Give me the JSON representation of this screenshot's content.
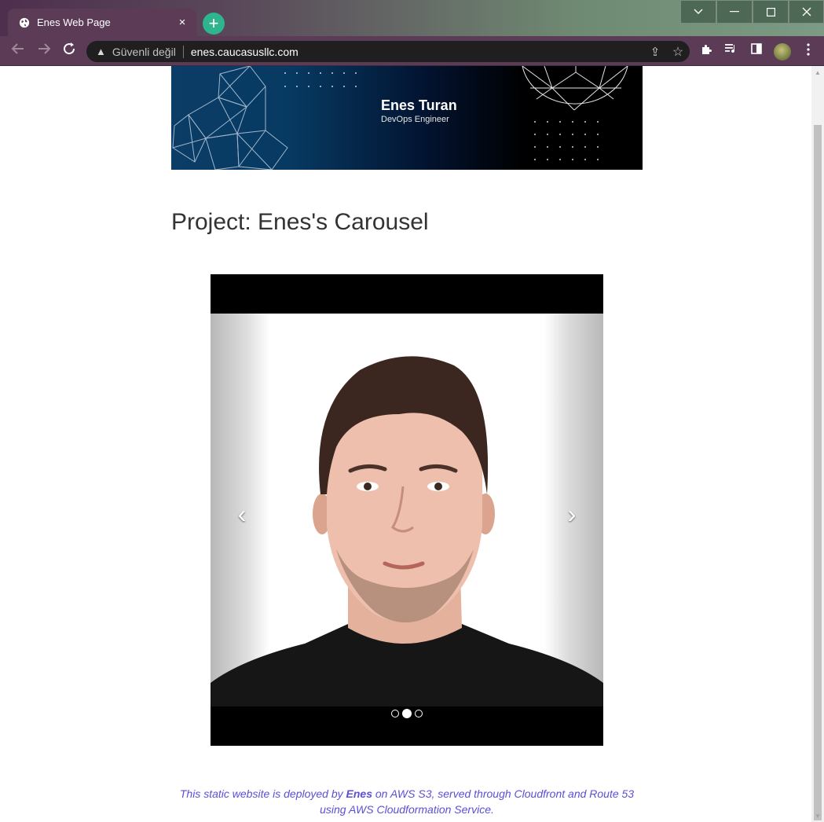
{
  "browser": {
    "tab_title": "Enes Web Page",
    "tab_close": "×",
    "new_tab": "+",
    "security_label": "Güvenli değil",
    "url": "enes.caucasusllc.com"
  },
  "page": {
    "banner": {
      "name": "Enes Turan",
      "role": "DevOps Engineer"
    },
    "project_title": "Project: Enes's Carousel",
    "carousel": {
      "slides_count": 3,
      "active_index": 1,
      "prev_glyph": "‹",
      "next_glyph": "›"
    },
    "footer": {
      "line_prefix": "This static website is deployed by ",
      "author": "Enes",
      "line_suffix": " on AWS S3, served through Cloudfront and Route 53 using AWS Cloudformation Service."
    }
  },
  "colors": {
    "footer_text": "#5b4fd8",
    "tab_bg": "#5c3b56",
    "new_tab_button": "#2fb58e"
  }
}
